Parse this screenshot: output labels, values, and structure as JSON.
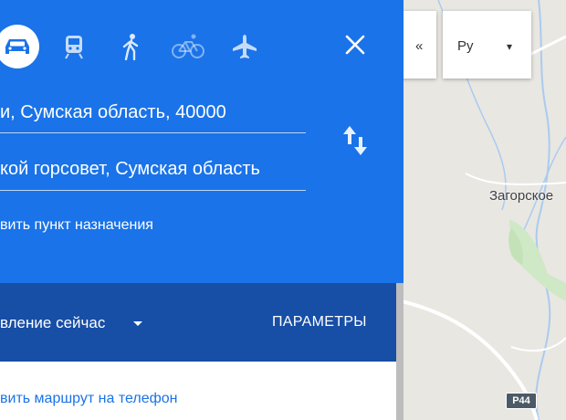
{
  "directions": {
    "modes": [
      {
        "name": "car-icon",
        "selected": true
      },
      {
        "name": "train-icon",
        "selected": false
      },
      {
        "name": "walk-icon",
        "selected": false
      },
      {
        "name": "bike-icon",
        "selected": false
      },
      {
        "name": "plane-icon",
        "selected": false
      }
    ],
    "origin": "и, Сумская область, 40000",
    "destination": "кой горсовет, Сумская область",
    "add_destination": "вить пункт назначения",
    "depart": "вление сейчас",
    "options_label": "ПАРАМЕТРЫ",
    "send_to_phone": "вить маршрут на телефон"
  },
  "map": {
    "place_label": "Загорское",
    "road_shield": "P44",
    "control_glyphs": [
      "«",
      "Ру",
      "▾"
    ]
  },
  "colors": {
    "panel_blue": "#1a73e8",
    "bar_blue": "#174ea6",
    "link_blue": "#1a73e8"
  }
}
